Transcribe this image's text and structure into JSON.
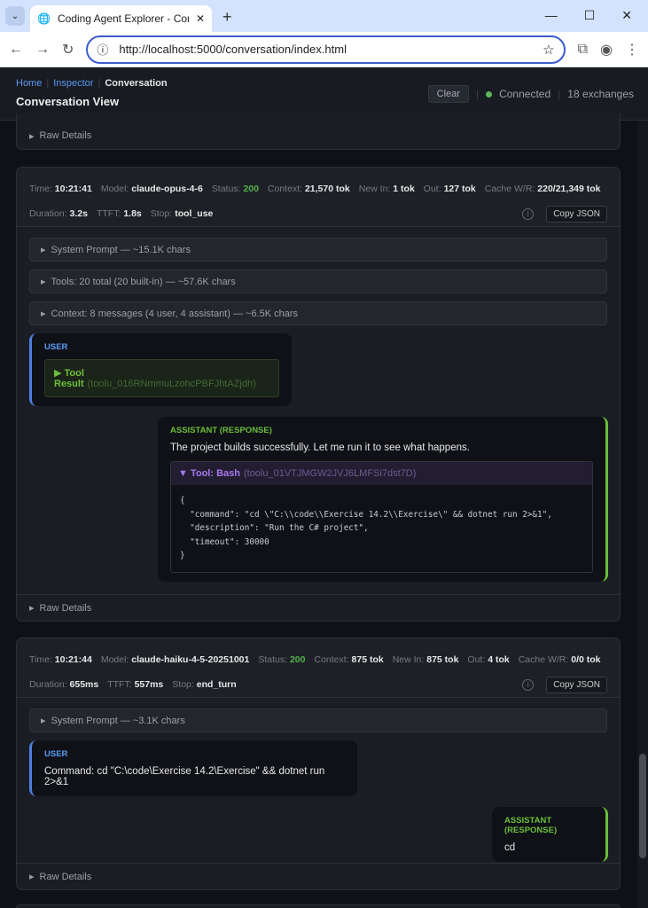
{
  "browser": {
    "tab_title": "Coding Agent Explorer - Conve",
    "url": "http://localhost:5000/conversation/index.html"
  },
  "header": {
    "breadcrumb": [
      "Home",
      "Inspector",
      "Conversation"
    ],
    "title": "Conversation View",
    "clear_label": "Clear",
    "status": "Connected",
    "exchanges": "18 exchanges"
  },
  "raw_details": "Raw Details",
  "exchanges": [
    {
      "time": "10:21:41",
      "model": "claude-opus-4-6",
      "status": "200",
      "context": "21,570 tok",
      "new_in": "1 tok",
      "out": "127 tok",
      "cache": "220/21,349 tok",
      "duration": "3.2s",
      "ttft": "1.8s",
      "stop": "tool_use",
      "sections": [
        "System Prompt — ~15.1K chars",
        "Tools: 20 total (20 built-in) — ~57.6K chars",
        "Context: 8 messages (4 user, 4 assistant) — ~6.5K chars"
      ],
      "user_role": "USER",
      "tool_result_label": "Tool Result",
      "tool_result_id": "(toolu_016RNmmuLzohcPBFJhtAZjdh)",
      "assistant_role": "ASSISTANT (RESPONSE)",
      "assistant_text": "The project builds successfully. Let me run it to see what happens.",
      "tool_label": "Tool: Bash",
      "tool_id": "(toolu_01VTJMGW2JVJ6LMFSi7dst7D)",
      "tool_input": "{\n  \"command\": \"cd \\\"C:\\\\code\\\\Exercise 14.2\\\\Exercise\\\" && dotnet run 2>&1\",\n  \"description\": \"Run the C# project\",\n  \"timeout\": 30000\n}"
    },
    {
      "time": "10:21:44",
      "model": "claude-haiku-4-5-20251001",
      "status": "200",
      "context": "875 tok",
      "new_in": "875 tok",
      "out": "4 tok",
      "cache": "0/0 tok",
      "duration": "655ms",
      "ttft": "557ms",
      "stop": "end_turn",
      "sections": [
        "System Prompt — ~3.1K chars"
      ],
      "user_role": "USER",
      "user_text": "Command: cd \"C:\\code\\Exercise 14.2\\Exercise\" && dotnet run 2>&1",
      "assistant_role": "ASSISTANT (RESPONSE)",
      "assistant_text": "cd"
    }
  ],
  "labels": {
    "time": "Time:",
    "model": "Model:",
    "status": "Status:",
    "context": "Context:",
    "new_in": "New In:",
    "out": "Out:",
    "cache": "Cache W/R:",
    "duration": "Duration:",
    "ttft": "TTFT:",
    "stop": "Stop:",
    "copy_json": "Copy JSON"
  }
}
